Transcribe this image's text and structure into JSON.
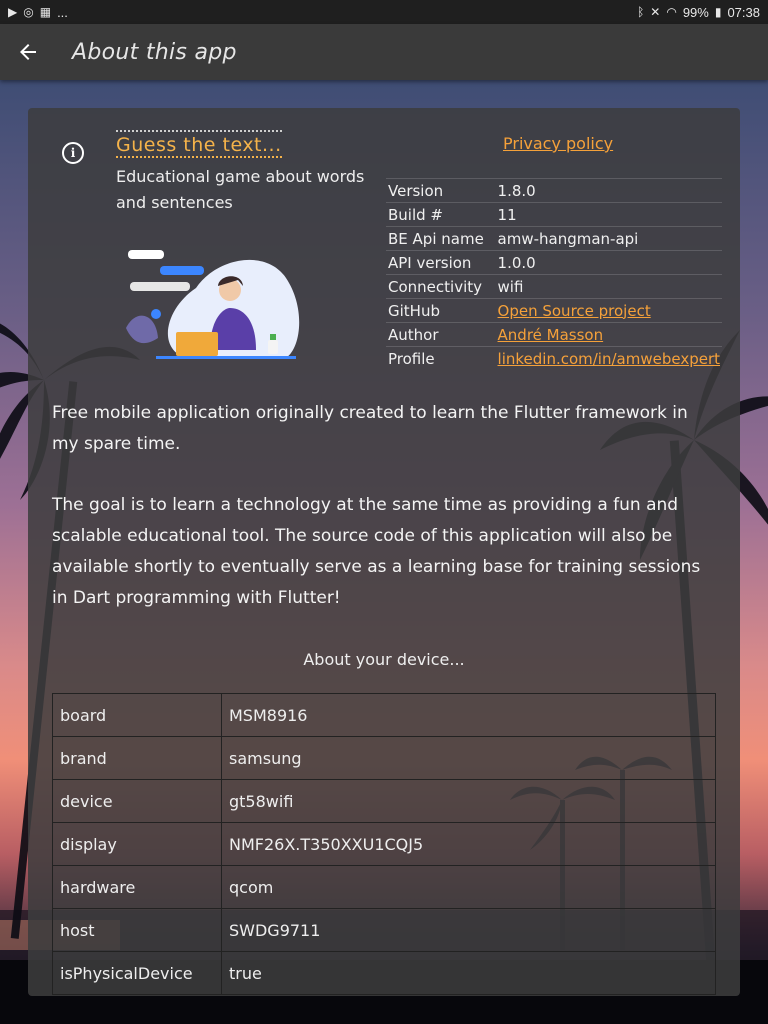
{
  "statusbar": {
    "left_icons": [
      "play-icon",
      "sync-icon",
      "calendar-icon"
    ],
    "more": "...",
    "battery": "99%",
    "time": "07:38"
  },
  "appbar": {
    "title": "About this app"
  },
  "app": {
    "name": "Guess the text...",
    "description": "Educational game about words and sentences",
    "privacy_label": "Privacy policy"
  },
  "info": [
    {
      "key": "Version",
      "value": "1.8.0",
      "link": false
    },
    {
      "key": "Build #",
      "value": "11",
      "link": false
    },
    {
      "key": "BE Api name",
      "value": "amw-hangman-api",
      "link": false
    },
    {
      "key": "API version",
      "value": "1.0.0",
      "link": false
    },
    {
      "key": "Connectivity",
      "value": "wifi",
      "link": false
    },
    {
      "key": "GitHub",
      "value": "Open Source project",
      "link": true
    },
    {
      "key": "Author",
      "value": "André Masson",
      "link": true
    },
    {
      "key": "Profile",
      "value": "linkedin.com/in/amwebexpert",
      "link": true
    }
  ],
  "paragraphs": [
    "Free mobile application originally created to learn the Flutter framework in my spare time.",
    "The goal is to learn a technology at the same time as providing a fun and scalable educational tool. The source code of this application will also be available shortly to eventually serve as a learning base for training sessions in Dart programming with Flutter!"
  ],
  "device": {
    "heading": "About your device...",
    "rows": [
      {
        "key": "board",
        "value": "MSM8916"
      },
      {
        "key": "brand",
        "value": "samsung"
      },
      {
        "key": "device",
        "value": "gt58wifi"
      },
      {
        "key": "display",
        "value": "NMF26X.T350XXU1CQJ5"
      },
      {
        "key": "hardware",
        "value": "qcom"
      },
      {
        "key": "host",
        "value": "SWDG9711"
      },
      {
        "key": "isPhysicalDevice",
        "value": "true"
      }
    ]
  },
  "colors": {
    "accent": "#f5a13a",
    "appbar": "#3a3a3a",
    "card": "#3c3c3e"
  }
}
